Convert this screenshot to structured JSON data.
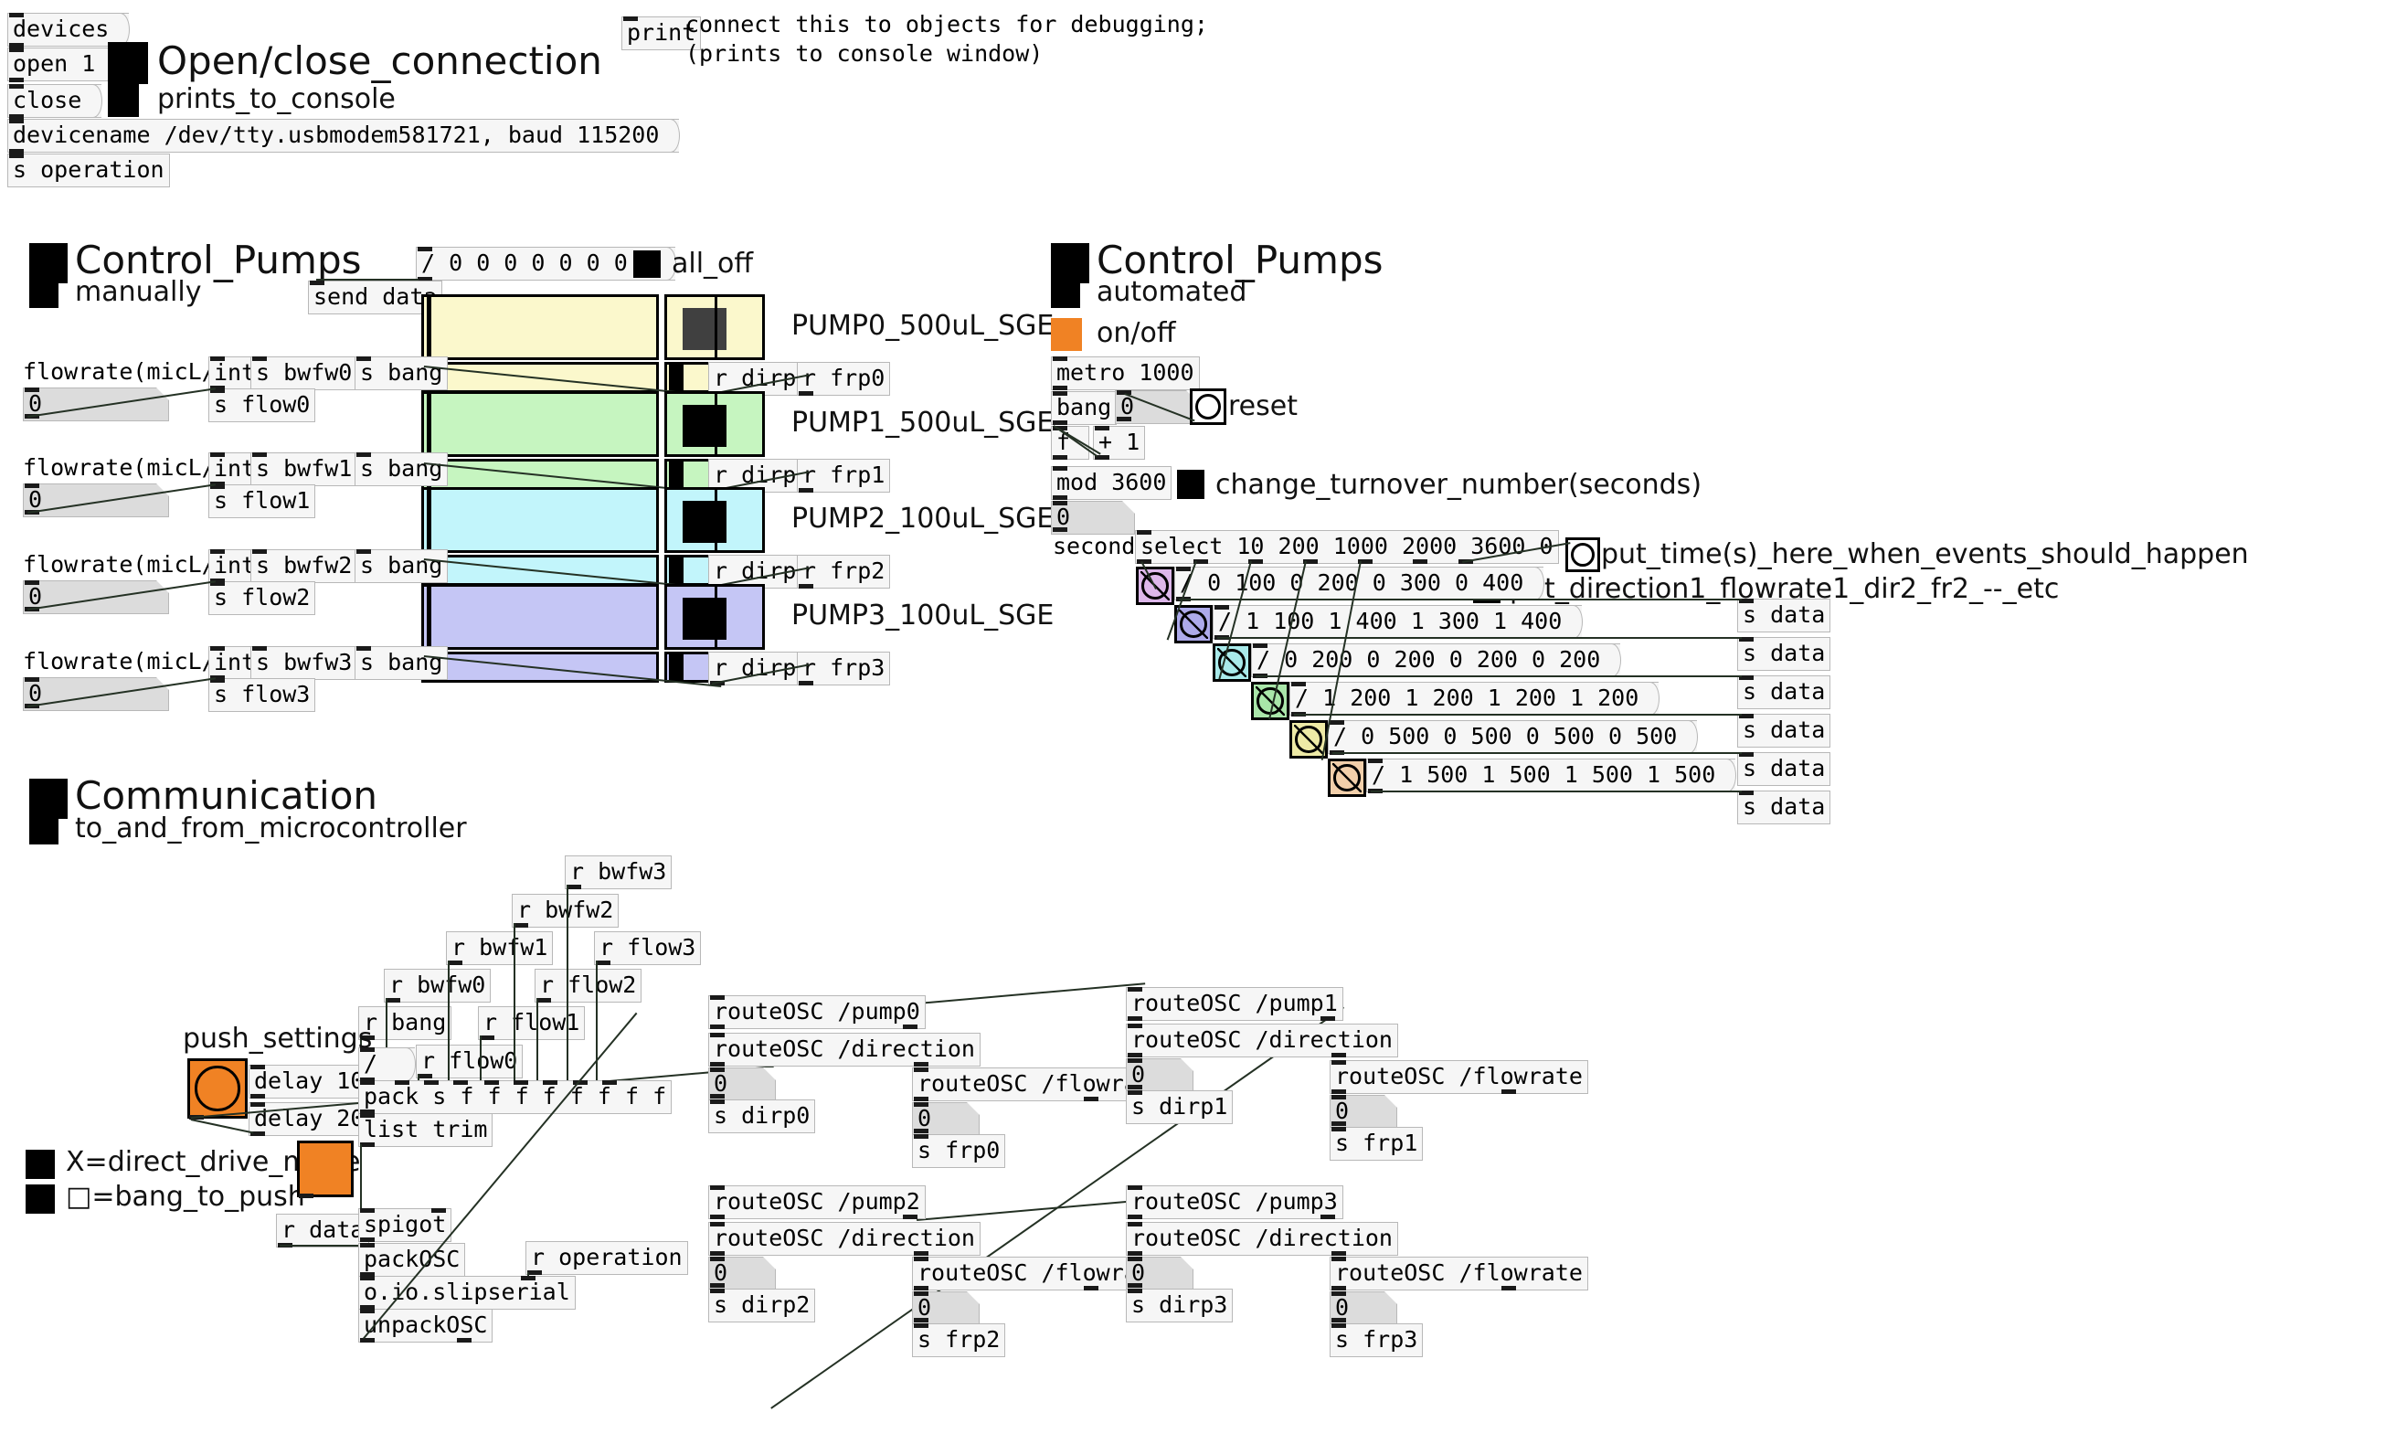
{
  "connection": {
    "devices_msg": "devices",
    "open_msg": "open 1",
    "close_msg": "close",
    "devicename_msg": "devicename /dev/tty.usbmodem581721, baud 115200",
    "send_obj": "s operation",
    "title": "Open/close_connection",
    "subtitle": "prints_to_console"
  },
  "debug": {
    "print_obj": "print",
    "comment_line1": "connect this to objects for debugging;",
    "comment_line2": "(prints to console window)"
  },
  "manual": {
    "title": "Control_Pumps",
    "subtitle": "manually",
    "alloff_msg": "/ 0 0 0 0 0 0 0 0",
    "alloff_label": "all_off",
    "send_data_obj": "send data",
    "pumps": [
      {
        "name": "PUMP0_500uL_SGE",
        "flow_label": "flowrate(micL/h)",
        "int_obj": "int",
        "bwfw_obj": "s bwfw0",
        "bang_obj": "s bang",
        "flow_obj": "s flow0",
        "num_value": "0",
        "r_dir": "r dirp0",
        "r_fr": "r frp0",
        "color": "#fbf8cc",
        "dir_state": "off"
      },
      {
        "name": "PUMP1_500uL_SGE",
        "flow_label": "flowrate(micL/h)",
        "int_obj": "int",
        "bwfw_obj": "s bwfw1",
        "bang_obj": "s bang",
        "flow_obj": "s flow1",
        "num_value": "0",
        "r_dir": "r dirp1",
        "r_fr": "r frp1",
        "color": "#c6f5c0",
        "dir_state": "on"
      },
      {
        "name": "PUMP2_100uL_SGE",
        "flow_label": "flowrate(micL/h)",
        "int_obj": "int",
        "bwfw_obj": "s bwfw2",
        "bang_obj": "s bang",
        "flow_obj": "s flow2",
        "num_value": "0",
        "r_dir": "r dirp2",
        "r_fr": "r frp2",
        "color": "#c2f5fb",
        "dir_state": "on"
      },
      {
        "name": "PUMP3_100uL_SGE",
        "flow_label": "flowrate(micL/h)",
        "int_obj": "int",
        "bwfw_obj": "s bwfw3",
        "bang_obj": "s bang",
        "flow_obj": "s flow3",
        "num_value": "0",
        "r_dir": "r dirp3",
        "r_fr": "r frp3",
        "color": "#c5c6f5",
        "dir_state": "on"
      }
    ]
  },
  "automated": {
    "title": "Control_Pumps",
    "subtitle": "automated",
    "onoff_label": "on/off",
    "onoff_color": "#f08224",
    "metro_obj": "metro 1000",
    "bang_obj": "bang",
    "bang_num": "0",
    "reset_label": "reset",
    "f_obj": "f",
    "plus_obj": "+ 1",
    "mod_obj": "mod 3600",
    "mod_num": "0",
    "turnover_label": "change_turnover_number(seconds)",
    "seconds_label": "seconds",
    "select_obj": "select 10 200 1000 2000 3600 0",
    "put_time_label": "put_time(s)_here_when_events_should_happen",
    "put_dir_label": "put_direction1_flowrate1_dir2_fr2_--_etc",
    "send_data_obj": "s data",
    "events": [
      {
        "msg": "/ 0 100 0 200 0 300 0 400",
        "bang_color": "#ddb7ea",
        "send": "s data"
      },
      {
        "msg": "/ 1 100 1 400 1 300 1 400",
        "bang_color": "#adaaea",
        "send": "s data"
      },
      {
        "msg": "/ 0 200 0 200 0 200 0 200",
        "bang_color": "#a9eaea",
        "send": "s data"
      },
      {
        "msg": "/ 1 200 1 200 1 200 1 200",
        "bang_color": "#a9e6a9",
        "send": "s data"
      },
      {
        "msg": "/ 0 500 0 500 0 500 0 500",
        "bang_color": "#eeeaa6",
        "send": "s data"
      },
      {
        "msg": "/ 1 500 1 500 1 500 1 500",
        "bang_color": "#f2cfaa",
        "send": "s data"
      }
    ]
  },
  "communication": {
    "title": "Communication",
    "subtitle": "to_and_from_microcontroller",
    "push_settings_label": "push_settings",
    "push_bang_color": "#f08224",
    "delay100_obj": "delay 100",
    "delay200_obj": "delay 200",
    "legend_x": "X=direct_drive_mode",
    "legend_box": "□=bang_to_push",
    "toggle_color": "#f08224",
    "receives": [
      "r bang",
      "r bwfw0",
      "r bwfw1",
      "r bwfw2",
      "r bwfw3",
      "r flow0",
      "r flow1",
      "r flow2",
      "r flow3"
    ],
    "slash_msg": "/",
    "pack_obj": "pack s f f f f f f f f",
    "list_trim_obj": "list trim",
    "r_data_obj": "r data",
    "spigot_obj": "spigot",
    "packosc_obj": "packOSC",
    "slipserial_obj": "o.io.slipserial",
    "unpackosc_obj": "unpackOSC",
    "r_operation_obj": "r operation",
    "routes": [
      {
        "pump": "routeOSC /pump0",
        "direction": "routeOSC /direction",
        "dir_num": "0",
        "s_dir": "s dirp0",
        "flowrate": "routeOSC /flowrate",
        "fr_num": "0",
        "s_fr": "s frp0"
      },
      {
        "pump": "routeOSC /pump1",
        "direction": "routeOSC /direction",
        "dir_num": "0",
        "s_dir": "s dirp1",
        "flowrate": "routeOSC /flowrate",
        "fr_num": "0",
        "s_fr": "s frp1"
      },
      {
        "pump": "routeOSC /pump2",
        "direction": "routeOSC /direction",
        "dir_num": "0",
        "s_dir": "s dirp2",
        "flowrate": "routeOSC /flowrate",
        "fr_num": "0",
        "s_fr": "s frp2"
      },
      {
        "pump": "routeOSC /pump3",
        "direction": "routeOSC /direction",
        "dir_num": "0",
        "s_dir": "s dirp3",
        "flowrate": "routeOSC /flowrate",
        "fr_num": "0",
        "s_fr": "s frp3"
      }
    ]
  }
}
